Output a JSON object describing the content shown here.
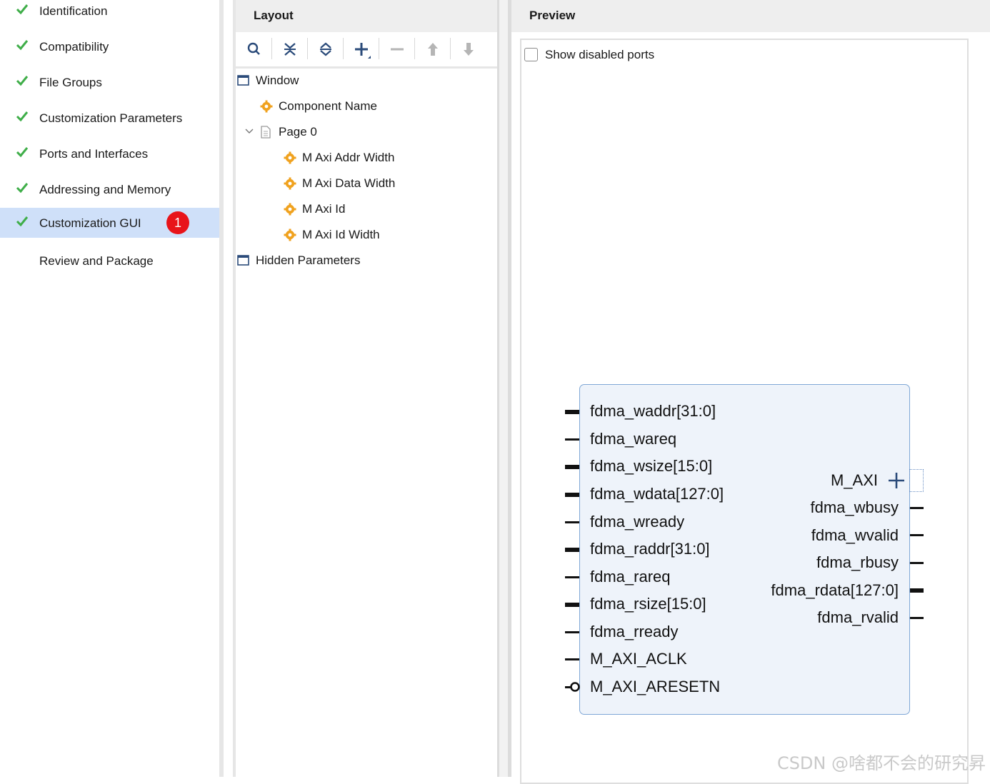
{
  "steps": {
    "items": [
      {
        "label": "Identification",
        "done": true
      },
      {
        "label": "Compatibility",
        "done": true
      },
      {
        "label": "File Groups",
        "done": true
      },
      {
        "label": "Customization Parameters",
        "done": true
      },
      {
        "label": "Ports and Interfaces",
        "done": true
      },
      {
        "label": "Addressing and Memory",
        "done": true
      },
      {
        "label": "Customization GUI",
        "done": true,
        "selected": true,
        "badge": "1"
      },
      {
        "label": "Review and Package",
        "done": false
      }
    ]
  },
  "layout": {
    "title": "Layout",
    "toolbar": [
      "search-icon",
      "collapse-all-icon",
      "expand-all-icon",
      "add-icon",
      "remove-icon",
      "move-up-icon",
      "move-down-icon"
    ],
    "tree": {
      "window": "Window",
      "component_name": "Component Name",
      "page0": "Page 0",
      "params": [
        "M Axi Addr Width",
        "M Axi Data Width",
        "M Axi Id",
        "M Axi Id Width"
      ],
      "hidden": "Hidden Parameters"
    }
  },
  "preview": {
    "title": "Preview",
    "show_disabled_ports": "Show disabled ports",
    "show_disabled_checked": false,
    "block": {
      "left_ports": [
        "fdma_waddr[31:0]",
        "fdma_wareq",
        "fdma_wsize[15:0]",
        "fdma_wdata[127:0]",
        "fdma_wready",
        "fdma_raddr[31:0]",
        "fdma_rareq",
        "fdma_rsize[15:0]",
        "fdma_rready",
        "M_AXI_ACLK",
        "M_AXI_ARESETN"
      ],
      "right_ports": [
        "M_AXI",
        "fdma_wbusy",
        "fdma_wvalid",
        "fdma_rbusy",
        "fdma_rdata[127:0]",
        "fdma_rvalid"
      ]
    }
  },
  "watermark": "CSDN @啥都不会的研究昇",
  "colors": {
    "check": "#3fae49",
    "selected_bg": "#cfe0f9",
    "badge": "#e8141a",
    "gear": "#f0a21f",
    "block_border": "#7fa7d6",
    "block_bg": "#eef3fa"
  }
}
